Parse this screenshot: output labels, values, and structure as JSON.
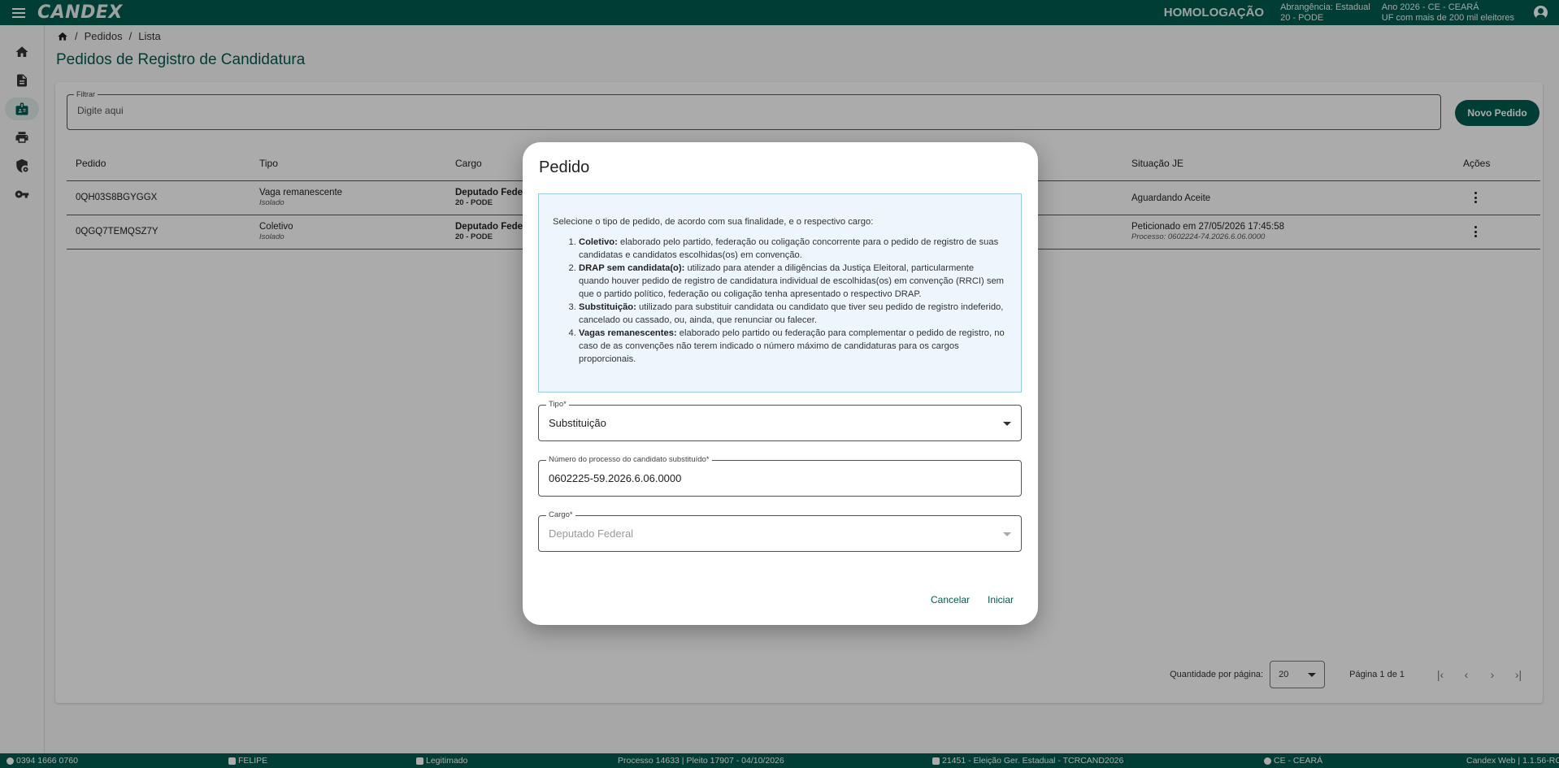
{
  "header": {
    "logo": "CANDEX",
    "environment": "HOMOLOGAÇÃO",
    "scope_line1": "Abrangência: Estadual",
    "scope_line2": "20 - PODE",
    "year_line1": "Ano 2026 - CE - CEARÁ",
    "year_line2": "UF com mais de 200 mil eleitores"
  },
  "sidebar": {
    "items": [
      {
        "icon": "home-icon"
      },
      {
        "icon": "document-icon"
      },
      {
        "icon": "badge-icon",
        "active": true
      },
      {
        "icon": "printer-icon"
      },
      {
        "icon": "security-settings-icon"
      },
      {
        "icon": "key-icon"
      }
    ]
  },
  "breadcrumb": {
    "items": [
      "Pedidos",
      "Lista"
    ],
    "separator": "/"
  },
  "page": {
    "title": "Pedidos de Registro de Candidatura"
  },
  "filter": {
    "label": "Filtrar",
    "placeholder": "Digite aqui"
  },
  "actions": {
    "new_request": "Novo Pedido"
  },
  "table": {
    "headers": {
      "pedido": "Pedido",
      "tipo": "Tipo",
      "cargo": "Cargo",
      "situacao": "Situação JE",
      "acoes": "Ações"
    },
    "rows": [
      {
        "pedido": "0QH03S8BGYGGX",
        "tipo": "Vaga remanescente",
        "tipo_sub": "Isolado",
        "cargo": "Deputado Federal",
        "cargo_sub": "20 - PODE",
        "situacao": "Aguardando Aceite",
        "situacao_sub": ""
      },
      {
        "pedido": "0QGQ7TEMQSZ7Y",
        "tipo": "Coletivo",
        "tipo_sub": "Isolado",
        "cargo": "Deputado Federal",
        "cargo_sub": "20 - PODE",
        "situacao": "Peticionado em 27/05/2026 17:45:58",
        "situacao_sub": "Processo: 0602224-74.2026.6.06.0000"
      }
    ]
  },
  "pagination": {
    "per_page_label": "Quantidade por página:",
    "per_page_value": "20",
    "page_info": "Página 1 de 1"
  },
  "dialog": {
    "title": "Pedido",
    "intro": "Selecione o tipo de pedido, de acordo com sua finalidade, e o respectivo cargo:",
    "options": [
      {
        "term": "Coletivo:",
        "text": " elaborado pelo partido, federação ou coligação concorrente para o pedido de registro de suas candidatas e candidatos escolhidas(os) em convenção."
      },
      {
        "term": "DRAP sem candidata(o):",
        "text": " utilizado para atender a diligências da Justiça Eleitoral, particularmente quando houver pedido de registro de candidatura individual de escolhidas(os) em convenção (RRCI) sem que o partido político, federação ou coligação tenha apresentado o respectivo DRAP."
      },
      {
        "term": "Substituição:",
        "text": " utilizado para substituir candidata ou candidato que tiver seu pedido de registro indeferido, cancelado ou cassado, ou, ainda, que renunciar ou falecer."
      },
      {
        "term": "Vagas remanescentes:",
        "text": " elaborado pelo partido ou federação para complementar o pedido de registro, no caso de as convenções não terem indicado o número máximo de candidaturas para os cargos proporcionais."
      }
    ],
    "tipo": {
      "label": "Tipo*",
      "value": "Substituição"
    },
    "processo": {
      "label": "Número do processo do candidato substituído*",
      "value": "0602225-59.2026.6.06.0000"
    },
    "cargo": {
      "label": "Cargo*",
      "value": "Deputado Federal"
    },
    "cancel": "Cancelar",
    "start": "Iniciar"
  },
  "footer": {
    "phone": "0394 1666 0760",
    "user": "FELIPE",
    "role": "Legitimado",
    "process": "Processo 14633 | Pleito 17907 - 04/10/2026",
    "election": "21451 - Eleição Ger. Estadual - TCRCAND2026",
    "state": "CE - CEARÁ",
    "version": "Candex Web | 1.1.56-RC"
  },
  "colors": {
    "primary": "#005c4e",
    "info_bg": "#eef6fd",
    "info_border": "#9cc8ea"
  }
}
